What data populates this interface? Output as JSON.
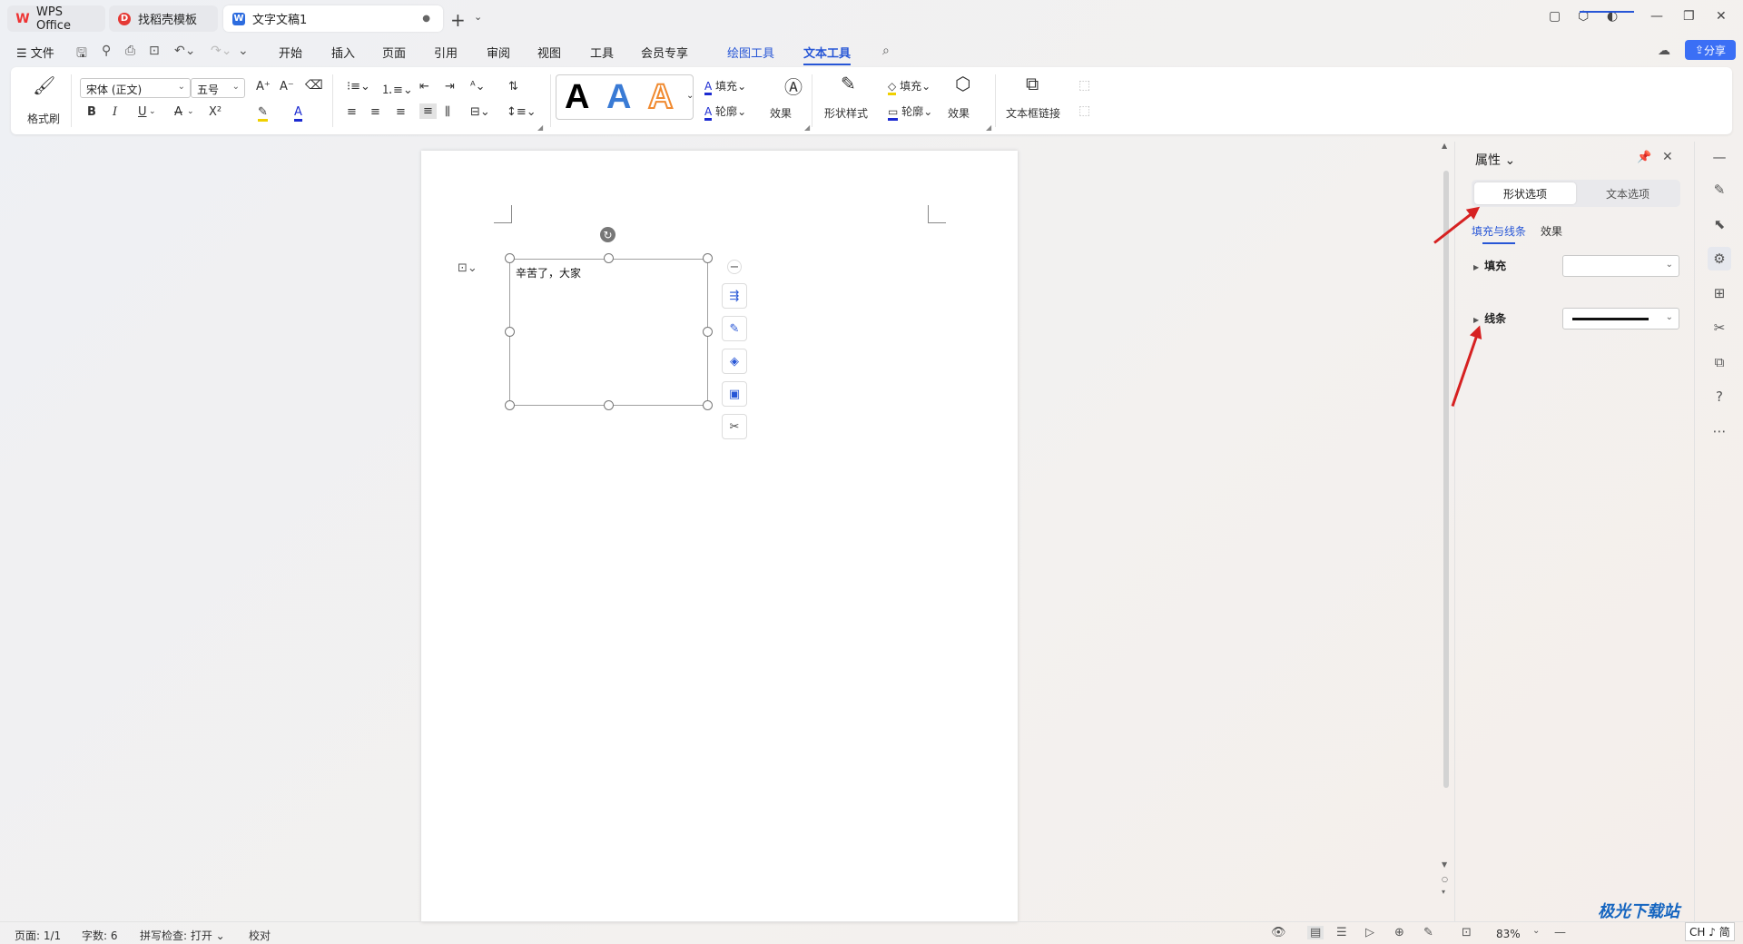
{
  "titlebar": {
    "tabs": [
      {
        "label": "WPS Office",
        "icon": "wps-logo-icon"
      },
      {
        "label": "找稻壳模板",
        "icon": "daoke-icon"
      },
      {
        "label": "文字文稿1",
        "icon": "word-doc-icon"
      }
    ]
  },
  "menubar": {
    "file": "文件",
    "items": [
      "开始",
      "插入",
      "页面",
      "引用",
      "审阅",
      "视图",
      "工具",
      "会员专享",
      "绘图工具",
      "文本工具"
    ],
    "share": "分享"
  },
  "ribbon": {
    "format_painter": "格式刷",
    "font_name": "宋体 (正文)",
    "font_size": "五号",
    "fill1": "填充",
    "outline1": "轮廓",
    "effect1": "效果",
    "shape_style": "形状样式",
    "fill2": "填充",
    "outline2": "轮廓",
    "effect2": "效果",
    "textbox_link": "文本框链接",
    "bold": "B",
    "italic": "I",
    "underline": "U",
    "strike": "A",
    "superscript": "X²"
  },
  "document": {
    "textbox_text": "辛苦了，大家"
  },
  "pane": {
    "title": "属性",
    "tab_shape": "形状选项",
    "tab_text": "文本选项",
    "subtab_fill_line": "填充与线条",
    "subtab_effect": "效果",
    "fill_label": "填充",
    "line_label": "线条"
  },
  "statusbar": {
    "page": "页面: 1/1",
    "words": "字数: 6",
    "spell": "拼写检查: 打开",
    "proof": "校对",
    "zoom": "83%"
  },
  "watermark": "极光下载站",
  "ime": "CH ♪ 简",
  "colors": {
    "accent": "#2756d6",
    "arrow": "#d62121",
    "share": "#3b6ff5"
  }
}
